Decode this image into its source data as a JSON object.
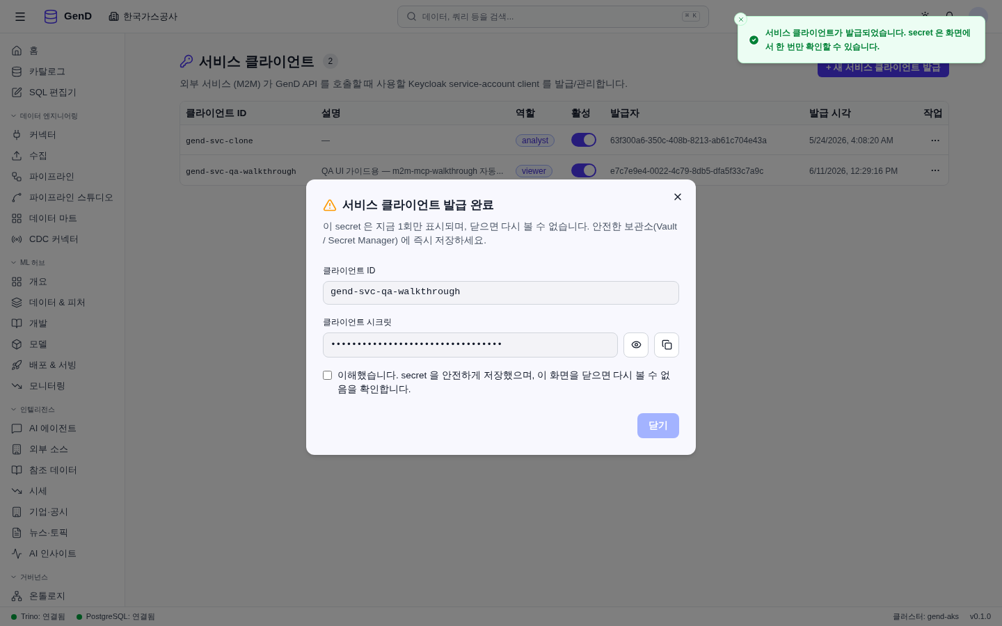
{
  "header": {
    "brand": "GenD",
    "org": "한국가스공사",
    "search": {
      "placeholder": "데이터, 쿼리 등을 검색...",
      "shortcut": "⌘ K"
    }
  },
  "sidebar": {
    "items": [
      {
        "label": "홈",
        "selected": false
      },
      {
        "label": "카탈로그",
        "selected": false
      },
      {
        "label": "SQL 편집기",
        "selected": false
      }
    ],
    "groups": [
      {
        "label": "데이터 엔지니어링",
        "expanded": true,
        "items": [
          {
            "label": "커넥터",
            "selected": false
          },
          {
            "label": "수집",
            "selected": false
          },
          {
            "label": "파이프라인",
            "selected": false
          },
          {
            "label": "파이프라인 스튜디오",
            "selected": false
          },
          {
            "label": "데이터 마트",
            "selected": false
          },
          {
            "label": "CDC 커넥터",
            "selected": false
          }
        ]
      },
      {
        "label": "ML 허브",
        "expanded": true,
        "items": [
          {
            "label": "개요",
            "selected": false
          },
          {
            "label": "데이터 & 피처",
            "selected": false
          },
          {
            "label": "개발",
            "selected": false
          },
          {
            "label": "모델",
            "selected": false
          },
          {
            "label": "배포 & 서빙",
            "selected": false
          },
          {
            "label": "모니터링",
            "selected": false
          }
        ]
      },
      {
        "label": "인텔리전스",
        "expanded": true,
        "items": [
          {
            "label": "AI 에이전트",
            "selected": false
          },
          {
            "label": "외부 소스",
            "selected": false
          },
          {
            "label": "참조 데이터",
            "selected": false
          },
          {
            "label": "시세",
            "selected": false
          },
          {
            "label": "기업·공시",
            "selected": false
          },
          {
            "label": "뉴스·토픽",
            "selected": false
          },
          {
            "label": "AI 인사이트",
            "selected": false
          }
        ]
      },
      {
        "label": "거버넌스",
        "expanded": true,
        "items": [
          {
            "label": "온톨로지",
            "selected": false
          }
        ]
      }
    ]
  },
  "page": {
    "title": "서비스 클라이언트",
    "count": "2",
    "subtitle": "외부 서비스 (M2M) 가 GenD API 를 호출할 때 사용할 Keycloak service-account client 를 발급/관리합니다.",
    "new_button": "+ 새 서비스 클라이언트 발급"
  },
  "table": {
    "columns": [
      "클라이언트 ID",
      "설명",
      "역할",
      "활성",
      "발급자",
      "발급 시각",
      "작업"
    ],
    "rows": [
      {
        "client_id": "gend-svc-clone",
        "description": "—",
        "role": "analyst",
        "active": true,
        "issuer": "63f300a6-350c-408b-8213-ab61c704e43a",
        "issued_at": "5/24/2026, 4:08:20 AM",
        "action": "···"
      },
      {
        "client_id": "gend-svc-qa-walkthrough",
        "description": "QA UI 가이드용 — m2m-mcp-walkthrough 자동...",
        "role": "viewer",
        "active": true,
        "issuer": "e7c7e9e4-0022-4c79-8db5-dfa5f33c7a9c",
        "issued_at": "6/11/2026, 12:29:16 PM",
        "action": "···"
      }
    ]
  },
  "dialog": {
    "title": "서비스 클라이언트 발급 완료",
    "description": "이 secret 은 지금 1회만 표시되며, 닫으면 다시 볼 수 없습니다. 안전한 보관소(Vault / Secret Manager) 에 즉시 저장하세요.",
    "client_id_label": "클라이언트 ID",
    "client_id": "gend-svc-qa-walkthrough",
    "secret_label": "클라이언트 시크릿",
    "secret_masked": "•••••••••••••••••••••••••••••••••",
    "confirm": {
      "label": "이해했습니다. secret 을 안전하게 저장했으며, 이 화면을 닫으면 다시 볼 수 없음을 확인합니다.",
      "checked": false
    },
    "close_button": {
      "label": "닫기",
      "disabled": true
    }
  },
  "toast": {
    "message": "서비스 클라이언트가 발급되었습니다. secret 은 화면에서 한 번만 확인할 수 있습니다."
  },
  "status_bar": {
    "connections": [
      {
        "label": "Trino: 연결됨"
      },
      {
        "label": "PostgreSQL: 연결됨"
      }
    ],
    "cluster": "클러스터: gend-aks",
    "version": "v0.1.0"
  }
}
